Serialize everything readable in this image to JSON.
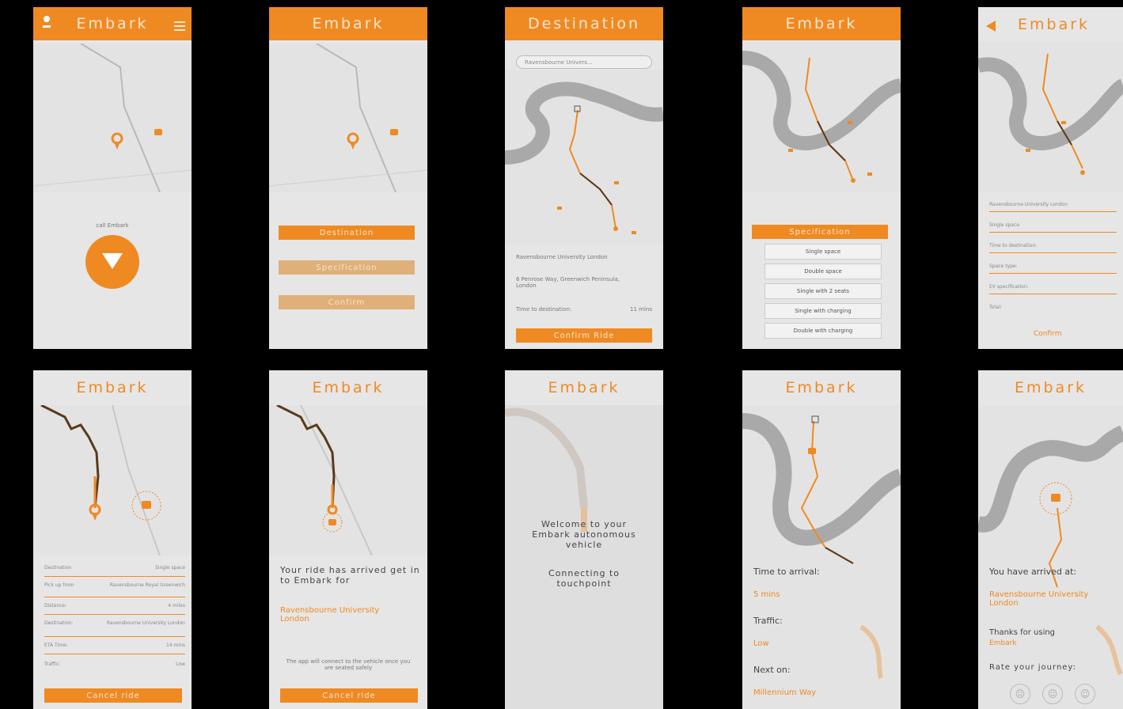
{
  "app_name": "Embark",
  "colors": {
    "accent": "#ef8a23",
    "background": "#e6e6e6",
    "river": "#a9a9a9",
    "route": "#5a3a1a"
  },
  "screen1": {
    "title": "Embark",
    "menu_icon": "hamburger-icon",
    "user_icon": "user-icon",
    "hint": "call Embark",
    "call_icon": "chevron-down-icon"
  },
  "screen2": {
    "title": "Embark",
    "buttons": [
      "Destination",
      "Specification",
      "Confirm"
    ]
  },
  "screen3": {
    "title": "Destination",
    "search_placeholder": "Ravensbourne Univers...",
    "destination": "Ravensbourne University London",
    "address": "6 Penrose Way, Greenwich Peninsula, London",
    "time_label": "Time to destination:",
    "time_value": "11 mins",
    "confirm": "Confirm Ride"
  },
  "screen4": {
    "title": "Embark",
    "spec_header": "Specification",
    "options": [
      "Single space",
      "Double space",
      "Single with 2 seats",
      "Single with charging",
      "Double with charging"
    ]
  },
  "screen5": {
    "title": "Embark",
    "back_icon": "back-arrow-icon",
    "rows": [
      "Ravensbourne University London",
      "Single space",
      "Time to destination:",
      "Space type:",
      "EV specification:",
      "Total:"
    ],
    "confirm": "Confirm"
  },
  "screen6": {
    "title": "Embark",
    "rows": [
      {
        "label": "Destination",
        "value": "Single space"
      },
      {
        "label": "Pick up from",
        "value": "Ravensbourne Royal Greenwich"
      },
      {
        "label": "Distance:",
        "value": "4 miles"
      },
      {
        "label": "Destination:",
        "value": "Ravensbourne University London"
      },
      {
        "label": "ETA Time:",
        "value": "14 mins"
      },
      {
        "label": "Traffic:",
        "value": "Low"
      }
    ],
    "cancel": "Cancel ride"
  },
  "screen7": {
    "title": "Embark",
    "message": "Your ride has arrived get in to Embark for",
    "destination": "Ravensbourne University London",
    "footnote": "The app will connect to the vehicle once you are seated safely",
    "cancel": "Cancel ride"
  },
  "screen8": {
    "title": "Embark",
    "welcome": "Welcome to your Embark autonomous vehicle",
    "connecting": "Connecting to touchpoint"
  },
  "screen9": {
    "title": "Embark",
    "time_label": "Time to arrival:",
    "time_value": "5 mins",
    "traffic_label": "Traffic:",
    "traffic_value": "Low",
    "next_label": "Next on:",
    "next_value": "Millennium Way"
  },
  "screen10": {
    "title": "Embark",
    "arrived": "You have arrived at:",
    "destination": "Ravensbourne University London",
    "thanks": "Thanks for using",
    "thanks_brand": "Embark",
    "rate": "Rate your journey:",
    "rate_icons": [
      "sad-face-icon",
      "neutral-face-icon",
      "happy-face-icon"
    ]
  }
}
